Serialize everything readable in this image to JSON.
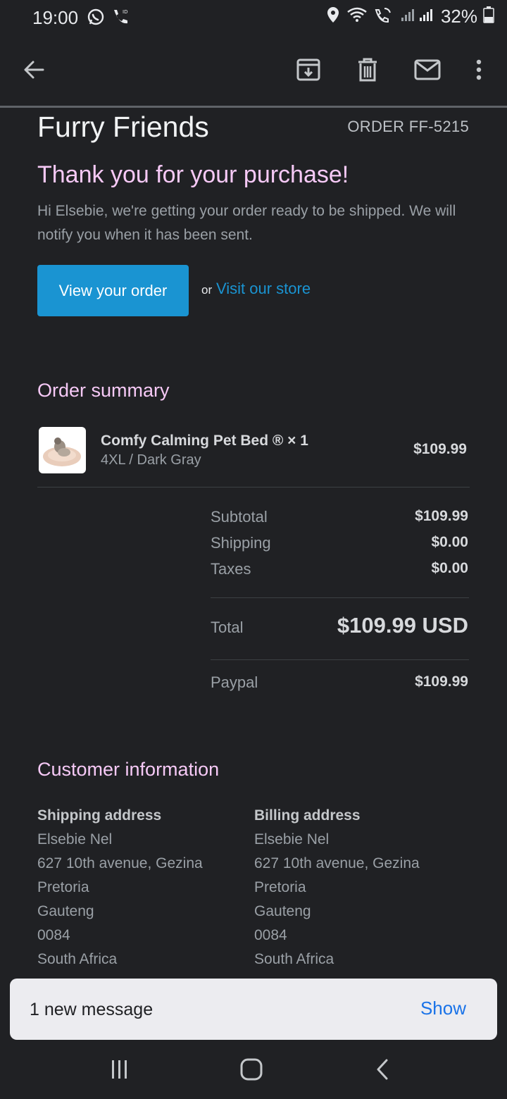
{
  "status_bar": {
    "time": "19:00",
    "battery": "32%"
  },
  "toolbar": {
    "back_icon": "arrow-back-icon",
    "archive_icon": "archive-icon",
    "delete_icon": "delete-icon",
    "mark_unread_icon": "mail-icon",
    "more_icon": "more-vert-icon"
  },
  "email": {
    "shop_name": "Furry Friends",
    "order_number": "ORDER FF-5215",
    "heading": "Thank you for your purchase!",
    "greeting": "Hi Elsebie, we're getting your order ready to be shipped. We will notify you when it has been sent.",
    "view_order_label": "View your order",
    "or_text": "or",
    "visit_store_label": "Visit our store"
  },
  "order_summary": {
    "heading": "Order summary",
    "item": {
      "name": "Comfy Calming Pet Bed ® × 1",
      "variant": "4XL / Dark Gray",
      "price": "$109.99"
    },
    "rows": [
      {
        "label": "Subtotal",
        "value": "$109.99"
      },
      {
        "label": "Shipping",
        "value": "$0.00"
      },
      {
        "label": "Taxes",
        "value": "$0.00"
      }
    ],
    "total_label": "Total",
    "total_value": "$109.99 USD",
    "payment_label": "Paypal",
    "payment_value": "$109.99"
  },
  "customer": {
    "heading": "Customer information",
    "shipping": {
      "heading": "Shipping address",
      "lines": [
        "Elsebie Nel",
        "627 10th avenue, Gezina",
        "Pretoria",
        "Gauteng",
        "0084",
        "South Africa"
      ]
    },
    "billing": {
      "heading": "Billing address",
      "lines": [
        "Elsebie Nel",
        "627 10th avenue, Gezina",
        "Pretoria",
        "Gauteng",
        "0084",
        "South Africa"
      ]
    }
  },
  "snackbar": {
    "message": "1 new message",
    "action": "Show"
  },
  "colors": {
    "background": "#202124",
    "accent_pink": "#f6c9f6",
    "button_blue": "#1a94d2",
    "snackbar_action": "#1a73e8"
  }
}
